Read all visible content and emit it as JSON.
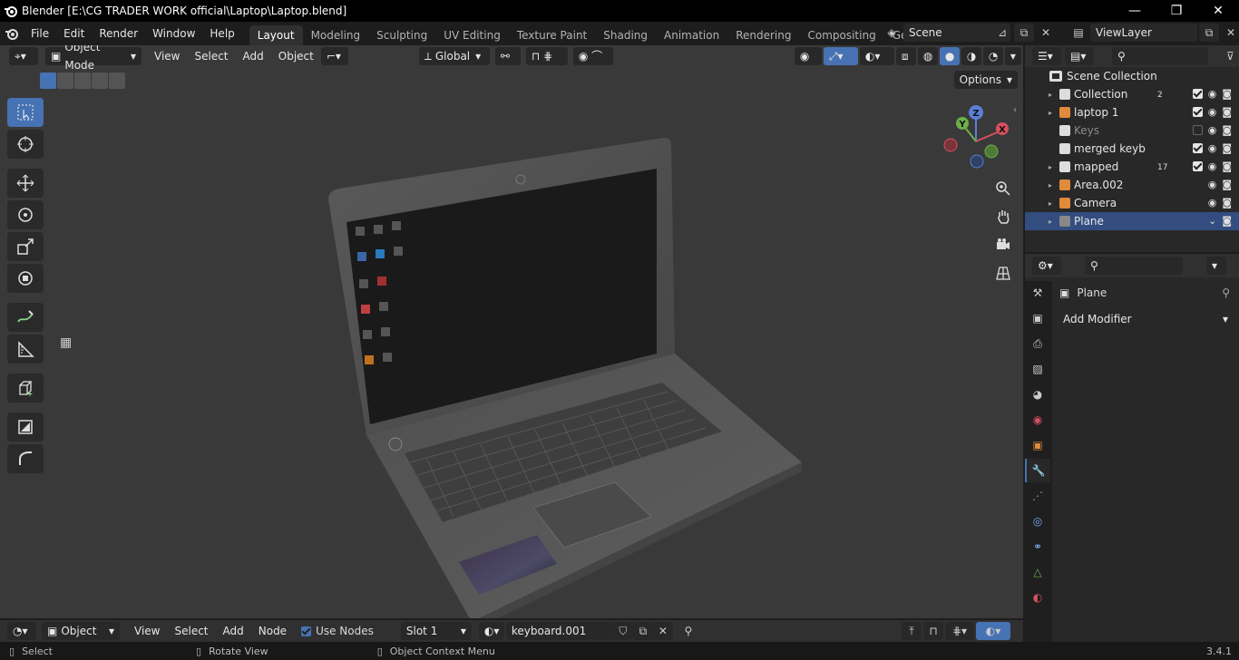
{
  "window": {
    "title": "Blender [E:\\CG TRADER WORK official\\Laptop\\Laptop.blend]",
    "controls": [
      "—",
      "❐",
      "✕"
    ]
  },
  "menu": [
    "File",
    "Edit",
    "Render",
    "Window",
    "Help"
  ],
  "workspaces": {
    "tabs": [
      "Layout",
      "Modeling",
      "Sculpting",
      "UV Editing",
      "Texture Paint",
      "Shading",
      "Animation",
      "Rendering",
      "Compositing",
      "Geometry Node"
    ],
    "active": "Layout"
  },
  "scene": {
    "name": "Scene",
    "view_layer": "ViewLayer"
  },
  "viewport": {
    "mode": "Object Mode",
    "menus": [
      "View",
      "Select",
      "Add",
      "Object"
    ],
    "orientation": "Global",
    "options_label": "Options"
  },
  "outliner": {
    "root": "Scene Collection",
    "items": [
      {
        "name": "Collection",
        "badge": "2",
        "expandable": true,
        "checked": true,
        "selected": false,
        "dim": false
      },
      {
        "name": "laptop 1",
        "badge": "",
        "expandable": true,
        "checked": true,
        "selected": false,
        "dim": false
      },
      {
        "name": "Keys",
        "badge": "",
        "expandable": false,
        "checked": false,
        "selected": false,
        "dim": true
      },
      {
        "name": "merged keyb",
        "badge": "",
        "expandable": false,
        "checked": true,
        "selected": false,
        "dim": false
      },
      {
        "name": "mapped",
        "badge": "17",
        "expandable": true,
        "checked": true,
        "selected": false,
        "dim": false
      },
      {
        "name": "Area.002",
        "badge": "",
        "expandable": true,
        "checked": null,
        "selected": false,
        "dim": false
      },
      {
        "name": "Camera",
        "badge": "",
        "expandable": true,
        "checked": null,
        "selected": false,
        "dim": false
      },
      {
        "name": "Plane",
        "badge": "",
        "expandable": true,
        "checked": null,
        "selected": true,
        "dim": false
      }
    ]
  },
  "properties": {
    "object_name": "Plane",
    "add_modifier_label": "Add Modifier"
  },
  "shader_header": {
    "mode": "Object",
    "menus": [
      "View",
      "Select",
      "Add",
      "Node"
    ],
    "use_nodes_label": "Use Nodes",
    "use_nodes_checked": true,
    "slot": "Slot 1",
    "material": "keyboard.001"
  },
  "status": {
    "select": "Select",
    "rotate": "Rotate View",
    "context_menu": "Object Context Menu",
    "version": "3.4.1"
  },
  "colors": {
    "accent": "#4772b3",
    "selection_row": "#334d80",
    "viewport_bg": "#393939"
  }
}
